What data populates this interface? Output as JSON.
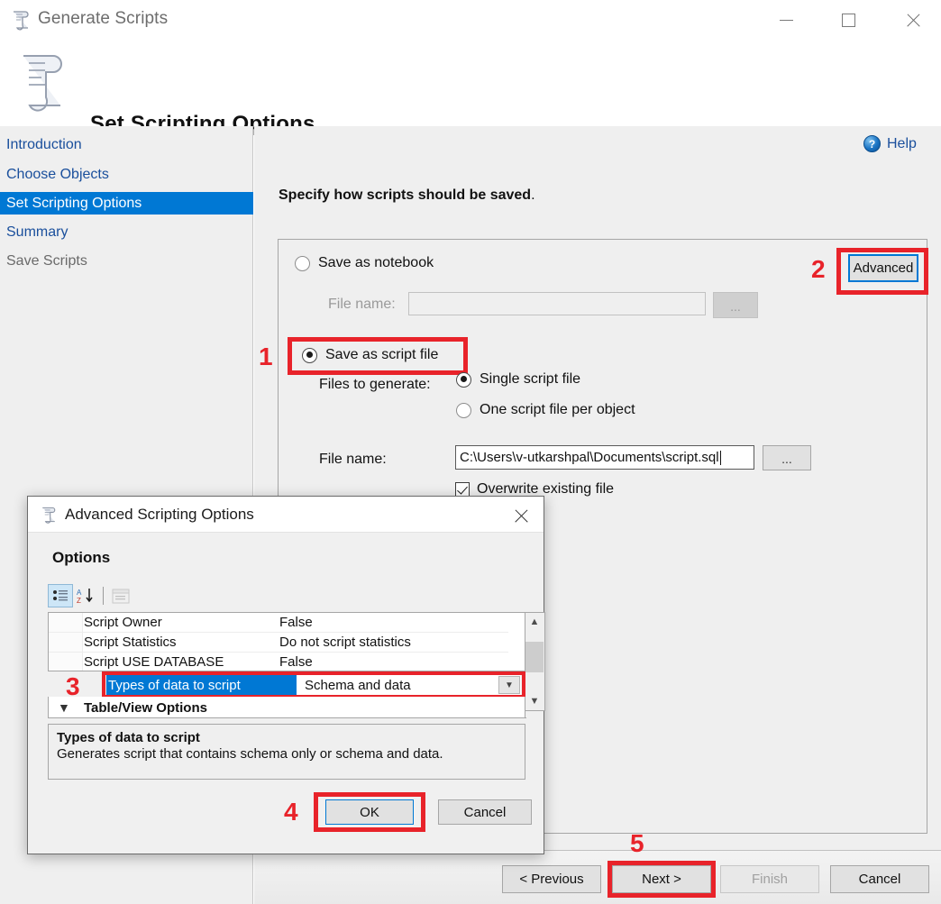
{
  "window": {
    "title": "Generate Scripts",
    "icon": "script-scroll-icon",
    "controls": {
      "minimize": "—",
      "maximize": "□",
      "close": "✕"
    }
  },
  "header": {
    "title": "Set Scripting Options",
    "icon": "script-scroll-icon"
  },
  "sidebar": {
    "items": [
      {
        "label": "Introduction",
        "state": "link"
      },
      {
        "label": "Choose Objects",
        "state": "link"
      },
      {
        "label": "Set Scripting Options",
        "state": "selected"
      },
      {
        "label": "Summary",
        "state": "link"
      },
      {
        "label": "Save Scripts",
        "state": "disabled"
      }
    ]
  },
  "main": {
    "help_label": "Help",
    "instruction_bold": "Specify how scripts should be saved",
    "instruction_tail": ".",
    "save_as_notebook": {
      "label": "Save as notebook",
      "selected": false
    },
    "advanced_button": "Advanced",
    "notebook_filename": {
      "label": "File name:",
      "value": "",
      "placeholder": "",
      "browse": "..."
    },
    "save_as_script_file": {
      "label": "Save as script file",
      "selected": true
    },
    "files_to_generate": {
      "label": "Files to generate:",
      "options": [
        {
          "label": "Single script file",
          "selected": true
        },
        {
          "label": "One script file per object",
          "selected": false
        }
      ]
    },
    "script_filename": {
      "label": "File name:",
      "value": "C:\\Users\\v-utkarshpal\\Documents\\script.sql",
      "browse": "..."
    },
    "overwrite": {
      "label": "Overwrite existing file",
      "checked": true
    }
  },
  "footer": {
    "previous": "< Previous",
    "next": "Next >",
    "finish": "Finish",
    "cancel": "Cancel"
  },
  "dialog": {
    "title": "Advanced Scripting Options",
    "icon": "script-scroll-icon",
    "close": "✕",
    "options_heading": "Options",
    "toolbar": [
      {
        "name": "categorized-view-icon",
        "pressed": true
      },
      {
        "name": "alphabetical-sort-icon",
        "pressed": false
      },
      {
        "name": "property-pages-icon",
        "pressed": false,
        "disabled": true
      }
    ],
    "grid_rows": [
      {
        "name": "Script Owner",
        "value": "False"
      },
      {
        "name": "Script Statistics",
        "value": "Do not script statistics"
      },
      {
        "name": "Script USE DATABASE",
        "value": "False"
      }
    ],
    "selected_row": {
      "name": "Types of data to script",
      "value": "Schema and data",
      "dropdown": "⌄"
    },
    "category_row": {
      "label": "Table/View Options",
      "chevron": "⌄"
    },
    "description": {
      "title": "Types of data to script",
      "body": "Generates script that contains schema only or schema and data."
    },
    "ok": "OK",
    "cancel": "Cancel"
  },
  "annotations": {
    "one": "1",
    "two": "2",
    "three": "3",
    "four": "4",
    "five": "5",
    "color": "#e8232a"
  },
  "colors": {
    "accent_blue": "#0078d4",
    "link_blue": "#1a4f9c",
    "annotation_red": "#e8232a",
    "panel_gray": "#efefef"
  }
}
